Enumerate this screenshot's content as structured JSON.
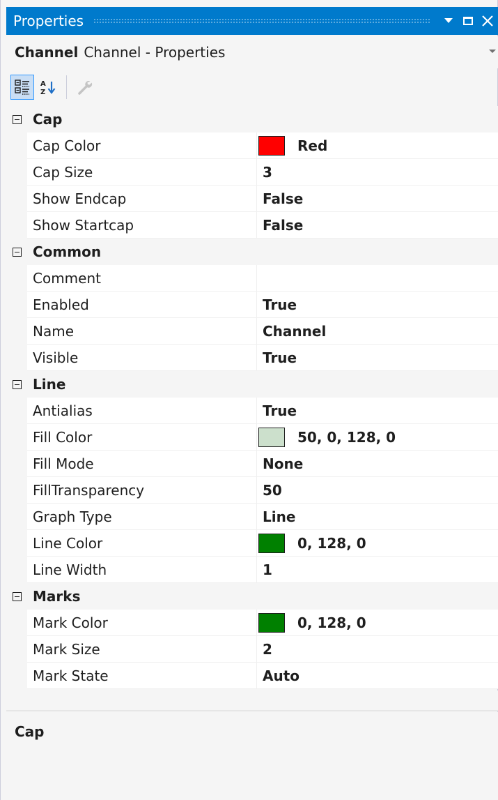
{
  "window": {
    "title": "Properties"
  },
  "selector": {
    "object_name": "Channel",
    "object_type": "Channel - Properties"
  },
  "toolbar": {
    "buttons": [
      {
        "name": "categorized",
        "icon": "categorized-icon",
        "active": true
      },
      {
        "name": "alphabetical",
        "icon": "sort-az-icon",
        "active": false
      },
      {
        "name": "property-pages",
        "icon": "wrench-icon",
        "active": false,
        "disabled": true
      }
    ]
  },
  "categories": [
    {
      "name": "Cap",
      "properties": [
        {
          "name": "Cap Color",
          "value": "Red",
          "swatch": "#ff0000"
        },
        {
          "name": "Cap Size",
          "value": "3"
        },
        {
          "name": "Show Endcap",
          "value": "False"
        },
        {
          "name": "Show Startcap",
          "value": "False"
        }
      ]
    },
    {
      "name": "Common",
      "properties": [
        {
          "name": "Comment",
          "value": ""
        },
        {
          "name": "Enabled",
          "value": "True"
        },
        {
          "name": "Name",
          "value": "Channel"
        },
        {
          "name": "Visible",
          "value": "True"
        }
      ]
    },
    {
      "name": "Line",
      "properties": [
        {
          "name": "Antialias",
          "value": "True"
        },
        {
          "name": "Fill Color",
          "value": "50, 0, 128, 0",
          "swatch": "#cce0cc"
        },
        {
          "name": "Fill Mode",
          "value": "None"
        },
        {
          "name": "FillTransparency",
          "value": "50"
        },
        {
          "name": "Graph Type",
          "value": "Line"
        },
        {
          "name": "Line Color",
          "value": "0, 128, 0",
          "swatch": "#008000"
        },
        {
          "name": "Line Width",
          "value": "1"
        }
      ]
    },
    {
      "name": "Marks",
      "properties": [
        {
          "name": "Mark Color",
          "value": "0, 128, 0",
          "swatch": "#008000"
        },
        {
          "name": "Mark Size",
          "value": "2"
        },
        {
          "name": "Mark State",
          "value": "Auto"
        }
      ]
    }
  ],
  "description": {
    "title": "Cap",
    "text": ""
  },
  "colors": {
    "accent": "#007acc",
    "panel_bg": "#f5f5f5",
    "grid_bg": "#ffffff"
  }
}
